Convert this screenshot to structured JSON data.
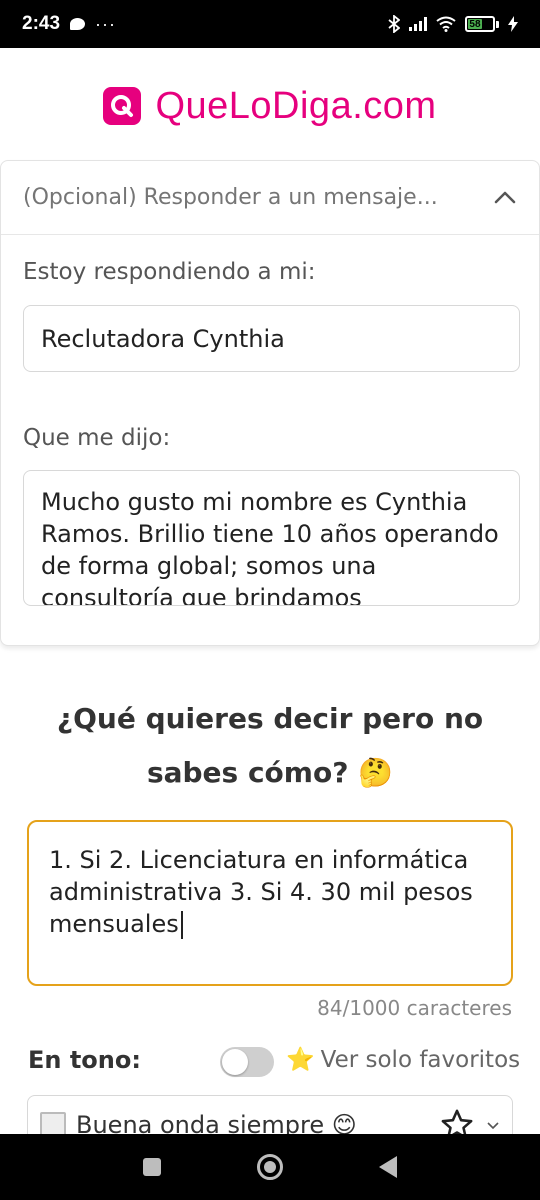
{
  "status_bar": {
    "time": "2:43",
    "more": "···",
    "battery": "58"
  },
  "header": {
    "brand": "QueLoDiga.com",
    "logo_letter": "Q",
    "accent_color": "#e6007e"
  },
  "reply_panel": {
    "title": "(Opcional) Responder a un mensaje...",
    "recipient_label": "Estoy respondiendo a mi:",
    "recipient_value": "Reclutadora Cynthia",
    "message_label": "Que me dijo:",
    "message_value": "Mucho gusto mi nombre es Cynthia Ramos. Brillio tiene 10 años operando de forma global; somos una consultoría que brindamos"
  },
  "main": {
    "question": "¿Qué quieres decir pero no sabes cómo? 🤔",
    "input_value": "1. Si 2. Licenciatura en informática administrativa 3. Si 4. 30 mil pesos mensuales",
    "char_count": "84/1000 caracteres",
    "input_border_color": "#e5a21a"
  },
  "tone": {
    "label": "En tono:",
    "favorites_toggle_label": "Ver solo favoritos",
    "favorites_icon": "⭐",
    "selected_option": "Buena onda siempre 😊"
  }
}
